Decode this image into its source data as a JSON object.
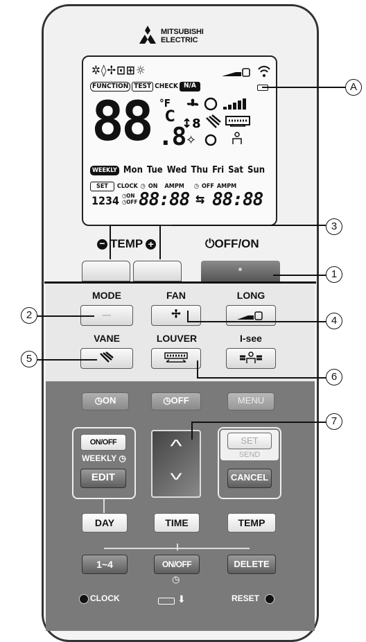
{
  "brand": {
    "line1": "MITSUBISHI",
    "line2": "ELECTRIC"
  },
  "lcd": {
    "labels": {
      "function": "FUNCTION",
      "test": "TEST",
      "check": "CHECK",
      "na": "N/A"
    },
    "big_digits": "88",
    "small_digit": ".8",
    "unit_f": "°F",
    "unit_c": "C",
    "weekly": "WEEKLY",
    "days": [
      "Mon",
      "Tue",
      "Wed",
      "Thu",
      "Fri",
      "Sat",
      "Sun"
    ],
    "set": "SET",
    "clock": "CLOCK",
    "on": "ON",
    "ampm": "AMPM",
    "off": "OFF",
    "nums": "1234",
    "time1": "88:88",
    "time2": "88:88"
  },
  "top_controls": {
    "temp_label": "TEMP",
    "offon_label": "OFF/ON"
  },
  "row1": {
    "mode": "MODE",
    "fan": "FAN",
    "long": "LONG"
  },
  "row2": {
    "vane": "VANE",
    "louver": "LOUVER",
    "isee": "I-see"
  },
  "timer": {
    "on": "ON",
    "off": "OFF",
    "menu": "MENU"
  },
  "weekly": {
    "onoff": "ON/OFF",
    "weekly": "WEEKLY",
    "edit": "EDIT",
    "set": "SET",
    "send": "SEND",
    "cancel": "CANCEL"
  },
  "bottom": {
    "day": "DAY",
    "time": "TIME",
    "temp": "TEMP",
    "range": "1~4",
    "onoff": "ON/OFF",
    "delete": "DELETE",
    "clock": "CLOCK",
    "reset": "RESET"
  },
  "callouts": {
    "a": "A",
    "c1": "1",
    "c2": "2",
    "c3": "3",
    "c4": "4",
    "c5": "5",
    "c6": "6",
    "c7": "7"
  }
}
